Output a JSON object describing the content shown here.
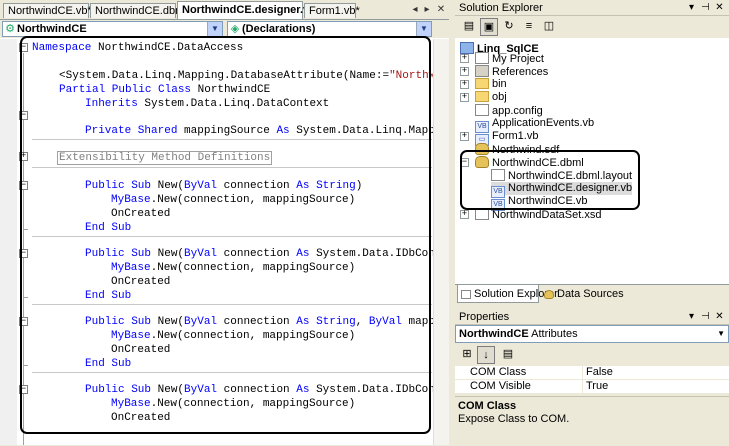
{
  "editor": {
    "tabs": [
      "NorthwindCE.vb*",
      "NorthwindCE.dbml",
      "NorthwindCE.designer.vb",
      "Form1.vb*"
    ],
    "active_tab_index": 2,
    "tab_controls": {
      "scroll_left": "◂",
      "scroll_right": "▸",
      "close": "✕"
    },
    "class_combo": "NorthwindCE",
    "member_combo": "(Declarations)",
    "code": [
      {
        "t": "kw",
        "a": "Namespace",
        " b": ""
      },
      {
        "t": "mix"
      }
    ]
  },
  "code_lines": {
    "l1_kw": "Namespace",
    "l1_rest": " NorthwindCE.DataAccess",
    "l2_a": "<System.Data.Linq.Mapping.DatabaseAttribute(Name:=",
    "l2_str": "\"Northwi",
    "l3_kw": "Partial Public Class",
    "l3_rest": " NorthwindCE",
    "l4_kw": "Inherits",
    "l4_rest": " System.Data.Linq.DataContext",
    "l5_kw1": "Private Shared",
    "l5_mid": " mappingSource ",
    "l5_kw2": "As",
    "l5_rest": " System.Data.Linq.Mappi",
    "l6_region": "Extensibility Method Definitions",
    "sub1_a": "Public Sub",
    "sub1_b": " New(",
    "sub1_c": "ByVal",
    "sub1_d": " connection ",
    "sub1_e": "As String",
    "sub1_f": ")",
    "mybase": "MyBase",
    "mybase_rest": ".New(connection, mappingSource)",
    "oncreated": "OnCreated",
    "endsub": "End Sub",
    "sub2_a": "Public Sub",
    "sub2_b": " New(",
    "sub2_c": "ByVal",
    "sub2_d": " connection ",
    "sub2_e": "As",
    "sub2_f": " System.Data.IDbConne",
    "sub3_a": "Public Sub",
    "sub3_b": " New(",
    "sub3_c": "ByVal",
    "sub3_d": " connection ",
    "sub3_e": "As String",
    "sub3_f": ", ",
    "sub3_g": "ByVal",
    "sub3_h": " mappi",
    "sub4_a": "Public Sub",
    "sub4_b": " New(",
    "sub4_c": "ByVal",
    "sub4_d": " connection ",
    "sub4_e": "As",
    "sub4_f": " System.Data.IDbConne"
  },
  "solution_explorer": {
    "title": "Solution Explorer",
    "title_buttons": {
      "pin": "▾",
      "autohide": "⊣",
      "close": "✕"
    },
    "tree": {
      "project": "Linq_SqlCE",
      "my_project": "My Project",
      "references": "References",
      "bin": "bin",
      "obj": "obj",
      "app_config": "app.config",
      "app_events": "ApplicationEvents.vb",
      "form1": "Form1.vb",
      "northwind_sdf": "Northwind.sdf",
      "dbml": "NorthwindCE.dbml",
      "dbml_layout": "NorthwindCE.dbml.layout",
      "designer": "NorthwindCE.designer.vb",
      "ce_vb": "NorthwindCE.vb",
      "dataset": "NorthwindDataSet.xsd"
    },
    "bottom_tabs": [
      "Solution Explorer",
      "Data Sources"
    ]
  },
  "properties": {
    "title": "Properties",
    "object_name": "NorthwindCE",
    "object_type": " Attributes",
    "rows": [
      {
        "name": "COM Class",
        "value": "False"
      },
      {
        "name": "COM Visible",
        "value": "True"
      }
    ],
    "desc_title": "COM Class",
    "desc_text": "Expose Class to COM."
  }
}
